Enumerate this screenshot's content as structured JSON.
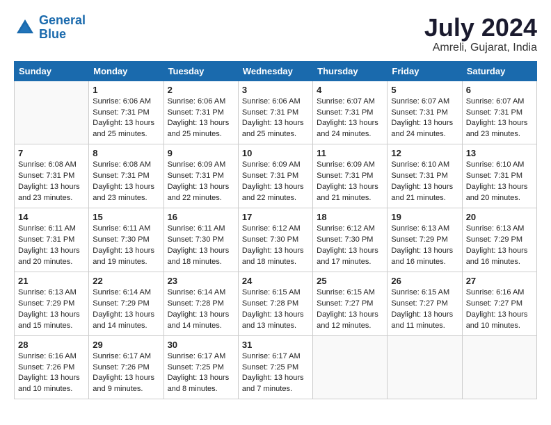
{
  "header": {
    "logo_line1": "General",
    "logo_line2": "Blue",
    "month_year": "July 2024",
    "location": "Amreli, Gujarat, India"
  },
  "weekdays": [
    "Sunday",
    "Monday",
    "Tuesday",
    "Wednesday",
    "Thursday",
    "Friday",
    "Saturday"
  ],
  "weeks": [
    [
      {
        "day": "",
        "info": ""
      },
      {
        "day": "1",
        "info": "Sunrise: 6:06 AM\nSunset: 7:31 PM\nDaylight: 13 hours\nand 25 minutes."
      },
      {
        "day": "2",
        "info": "Sunrise: 6:06 AM\nSunset: 7:31 PM\nDaylight: 13 hours\nand 25 minutes."
      },
      {
        "day": "3",
        "info": "Sunrise: 6:06 AM\nSunset: 7:31 PM\nDaylight: 13 hours\nand 25 minutes."
      },
      {
        "day": "4",
        "info": "Sunrise: 6:07 AM\nSunset: 7:31 PM\nDaylight: 13 hours\nand 24 minutes."
      },
      {
        "day": "5",
        "info": "Sunrise: 6:07 AM\nSunset: 7:31 PM\nDaylight: 13 hours\nand 24 minutes."
      },
      {
        "day": "6",
        "info": "Sunrise: 6:07 AM\nSunset: 7:31 PM\nDaylight: 13 hours\nand 23 minutes."
      }
    ],
    [
      {
        "day": "7",
        "info": ""
      },
      {
        "day": "8",
        "info": "Sunrise: 6:08 AM\nSunset: 7:31 PM\nDaylight: 13 hours\nand 23 minutes."
      },
      {
        "day": "9",
        "info": "Sunrise: 6:09 AM\nSunset: 7:31 PM\nDaylight: 13 hours\nand 22 minutes."
      },
      {
        "day": "10",
        "info": "Sunrise: 6:09 AM\nSunset: 7:31 PM\nDaylight: 13 hours\nand 22 minutes."
      },
      {
        "day": "11",
        "info": "Sunrise: 6:09 AM\nSunset: 7:31 PM\nDaylight: 13 hours\nand 21 minutes."
      },
      {
        "day": "12",
        "info": "Sunrise: 6:10 AM\nSunset: 7:31 PM\nDaylight: 13 hours\nand 21 minutes."
      },
      {
        "day": "13",
        "info": "Sunrise: 6:10 AM\nSunset: 7:31 PM\nDaylight: 13 hours\nand 20 minutes."
      }
    ],
    [
      {
        "day": "14",
        "info": ""
      },
      {
        "day": "15",
        "info": "Sunrise: 6:11 AM\nSunset: 7:30 PM\nDaylight: 13 hours\nand 19 minutes."
      },
      {
        "day": "16",
        "info": "Sunrise: 6:11 AM\nSunset: 7:30 PM\nDaylight: 13 hours\nand 18 minutes."
      },
      {
        "day": "17",
        "info": "Sunrise: 6:12 AM\nSunset: 7:30 PM\nDaylight: 13 hours\nand 18 minutes."
      },
      {
        "day": "18",
        "info": "Sunrise: 6:12 AM\nSunset: 7:30 PM\nDaylight: 13 hours\nand 17 minutes."
      },
      {
        "day": "19",
        "info": "Sunrise: 6:13 AM\nSunset: 7:29 PM\nDaylight: 13 hours\nand 16 minutes."
      },
      {
        "day": "20",
        "info": "Sunrise: 6:13 AM\nSunset: 7:29 PM\nDaylight: 13 hours\nand 16 minutes."
      }
    ],
    [
      {
        "day": "21",
        "info": ""
      },
      {
        "day": "22",
        "info": "Sunrise: 6:14 AM\nSunset: 7:29 PM\nDaylight: 13 hours\nand 14 minutes."
      },
      {
        "day": "23",
        "info": "Sunrise: 6:14 AM\nSunset: 7:28 PM\nDaylight: 13 hours\nand 14 minutes."
      },
      {
        "day": "24",
        "info": "Sunrise: 6:15 AM\nSunset: 7:28 PM\nDaylight: 13 hours\nand 13 minutes."
      },
      {
        "day": "25",
        "info": "Sunrise: 6:15 AM\nSunset: 7:27 PM\nDaylight: 13 hours\nand 12 minutes."
      },
      {
        "day": "26",
        "info": "Sunrise: 6:15 AM\nSunset: 7:27 PM\nDaylight: 13 hours\nand 11 minutes."
      },
      {
        "day": "27",
        "info": "Sunrise: 6:16 AM\nSunset: 7:27 PM\nDaylight: 13 hours\nand 10 minutes."
      }
    ],
    [
      {
        "day": "28",
        "info": "Sunrise: 6:16 AM\nSunset: 7:26 PM\nDaylight: 13 hours\nand 10 minutes."
      },
      {
        "day": "29",
        "info": "Sunrise: 6:17 AM\nSunset: 7:26 PM\nDaylight: 13 hours\nand 9 minutes."
      },
      {
        "day": "30",
        "info": "Sunrise: 6:17 AM\nSunset: 7:25 PM\nDaylight: 13 hours\nand 8 minutes."
      },
      {
        "day": "31",
        "info": "Sunrise: 6:17 AM\nSunset: 7:25 PM\nDaylight: 13 hours\nand 7 minutes."
      },
      {
        "day": "",
        "info": ""
      },
      {
        "day": "",
        "info": ""
      },
      {
        "day": "",
        "info": ""
      }
    ]
  ],
  "week1_sun_info": "Sunrise: 6:08 AM\nSunset: 7:31 PM\nDaylight: 13 hours\nand 23 minutes.",
  "week2_sun_info": "Sunrise: 6:11 AM\nSunset: 7:31 PM\nDaylight: 13 hours\nand 20 minutes.",
  "week3_sun_info": "Sunrise: 6:13 AM\nSunset: 7:29 PM\nDaylight: 13 hours\nand 15 minutes.",
  "week4_sun_info": "Sunrise: 6:13 AM\nSunset: 7:29 PM\nDaylight: 13 hours\nand 15 minutes."
}
